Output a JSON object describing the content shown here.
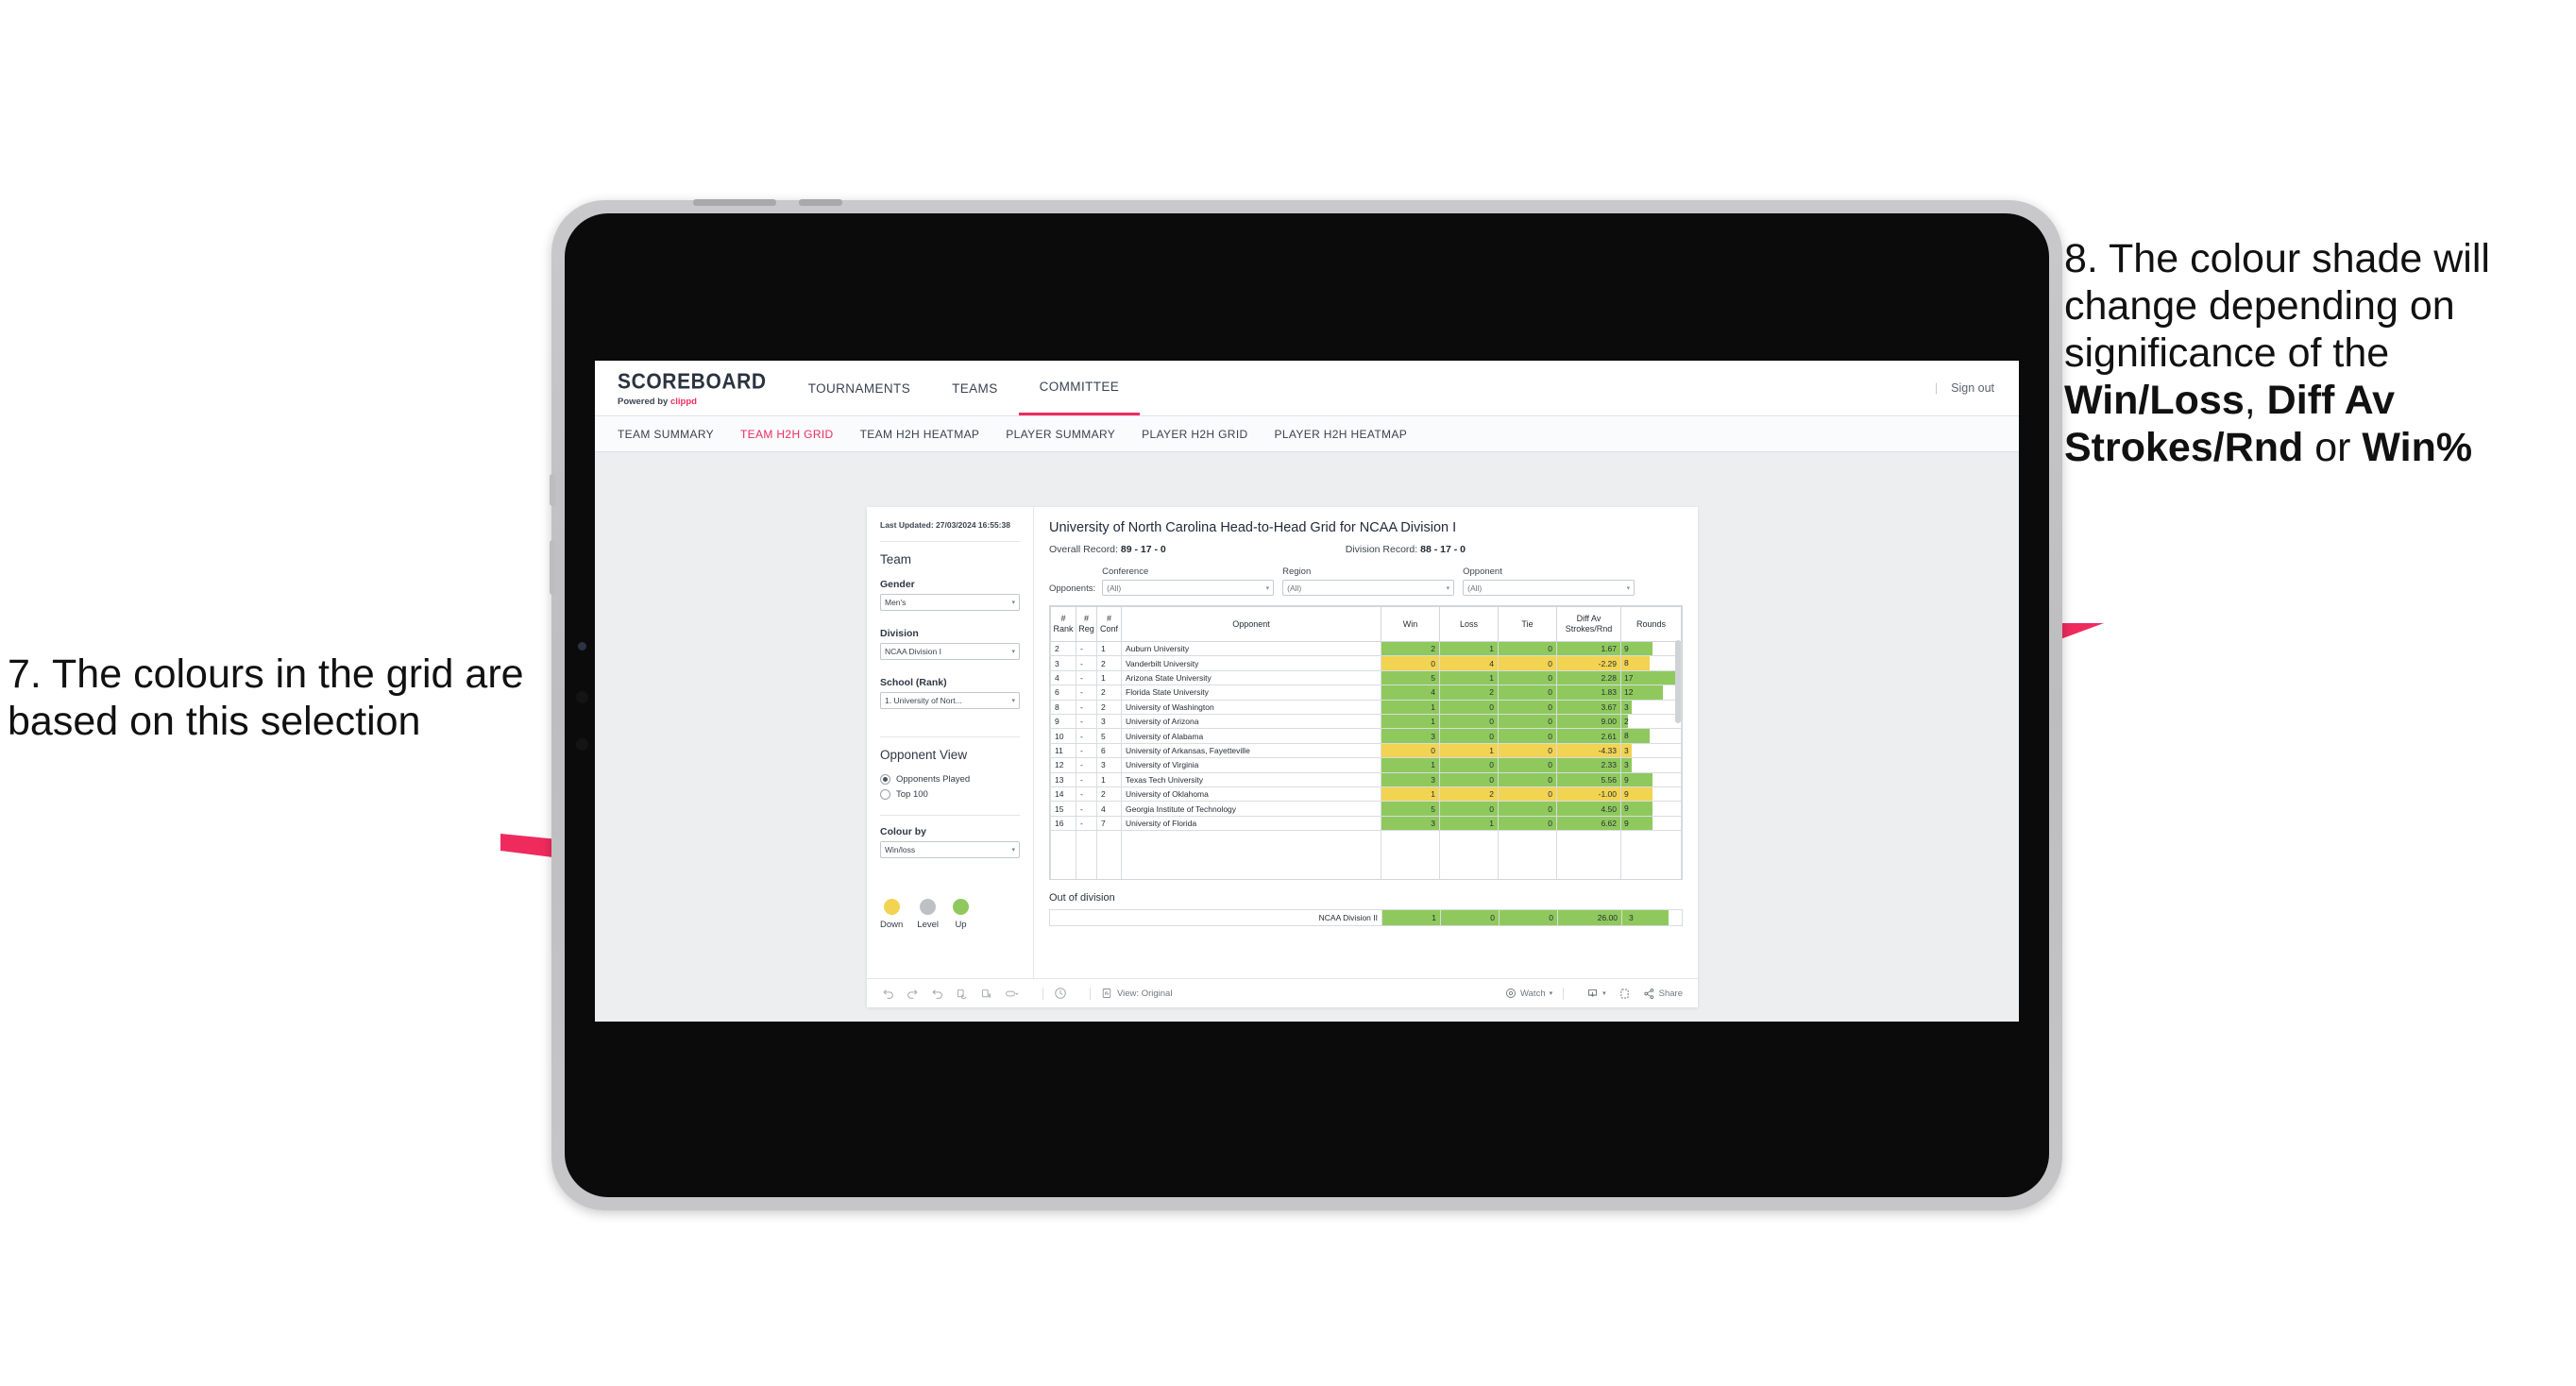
{
  "annotations": {
    "left": {
      "text": "7. The colours in the grid are based on this selection"
    },
    "right": {
      "pre": "8. The colour shade will change depending on significance of the ",
      "b1": "Win/Loss",
      "mid1": ", ",
      "b2": "Diff Av Strokes/Rnd",
      "mid2": " or ",
      "b3": "Win%"
    },
    "arrow_color": "#ef2b5e"
  },
  "app": {
    "brand": {
      "title": "SCOREBOARD",
      "powered_pre": "Powered by ",
      "powered_brand": "clippd"
    },
    "nav": [
      {
        "label": "TOURNAMENTS",
        "active": false
      },
      {
        "label": "TEAMS",
        "active": false
      },
      {
        "label": "COMMITTEE",
        "active": true
      }
    ],
    "sign_out": "Sign out",
    "subnav": [
      {
        "label": "TEAM SUMMARY",
        "active": false
      },
      {
        "label": "TEAM H2H GRID",
        "active": true
      },
      {
        "label": "TEAM H2H HEATMAP",
        "active": false
      },
      {
        "label": "PLAYER SUMMARY",
        "active": false
      },
      {
        "label": "PLAYER H2H GRID",
        "active": false
      },
      {
        "label": "PLAYER H2H HEATMAP",
        "active": false
      }
    ]
  },
  "sidebar": {
    "last_updated": "Last Updated: 27/03/2024 16:55:38",
    "team_heading": "Team",
    "gender": {
      "label": "Gender",
      "value": "Men's"
    },
    "division": {
      "label": "Division",
      "value": "NCAA Division I"
    },
    "school": {
      "label": "School (Rank)",
      "value": "1. University of Nort..."
    },
    "opponent_view": {
      "heading": "Opponent View",
      "options": [
        {
          "label": "Opponents Played",
          "selected": true
        },
        {
          "label": "Top 100",
          "selected": false
        }
      ]
    },
    "colour_by": {
      "label": "Colour by",
      "value": "Win/loss"
    },
    "legend": [
      {
        "label": "Down",
        "color": "#f2d352"
      },
      {
        "label": "Level",
        "color": "#bdc1c6"
      },
      {
        "label": "Up",
        "color": "#8fc95d"
      }
    ]
  },
  "viz": {
    "title": "University of North Carolina Head-to-Head Grid for NCAA Division I",
    "overall_record_label": "Overall Record: ",
    "overall_record_value": "89 - 17 - 0",
    "division_record_label": "Division Record: ",
    "division_record_value": "88 - 17 - 0",
    "opponents_label": "Opponents:",
    "filters": [
      {
        "label": "Conference",
        "value": "(All)"
      },
      {
        "label": "Region",
        "value": "(All)"
      },
      {
        "label": "Opponent",
        "value": "(All)"
      }
    ],
    "out_of_division_title": "Out of division"
  },
  "chart_data": {
    "type": "table",
    "title": "University of North Carolina Head-to-Head Grid for NCAA Division I",
    "columns": [
      "# Rank",
      "# Reg",
      "# Conf",
      "Opponent",
      "Win",
      "Loss",
      "Tie",
      "Diff Av Strokes/Rnd",
      "Rounds"
    ],
    "column_header_lines": [
      [
        "#",
        "Rank"
      ],
      [
        "#",
        "Reg"
      ],
      [
        "#",
        "Conf"
      ],
      [
        "Opponent"
      ],
      [
        "Win"
      ],
      [
        "Loss"
      ],
      [
        "Tie"
      ],
      [
        "Diff Av",
        "Strokes/Rnd"
      ],
      [
        "Rounds"
      ]
    ],
    "colour_scale": {
      "up": "#8fc95d",
      "down": "#f2d352",
      "level": "#bdc1c6"
    },
    "rounds_max": 17,
    "rows": [
      {
        "rank": "2",
        "reg": "-",
        "conf": "1",
        "opponent": "Auburn University",
        "win": "2",
        "loss": "1",
        "tie": "0",
        "diff": "1.67",
        "rounds": "9",
        "rounds_val": 9,
        "shade": "up"
      },
      {
        "rank": "3",
        "reg": "-",
        "conf": "2",
        "opponent": "Vanderbilt University",
        "win": "0",
        "loss": "4",
        "tie": "0",
        "diff": "-2.29",
        "rounds": "8",
        "rounds_val": 8,
        "shade": "down"
      },
      {
        "rank": "4",
        "reg": "-",
        "conf": "1",
        "opponent": "Arizona State University",
        "win": "5",
        "loss": "1",
        "tie": "0",
        "diff": "2.28",
        "rounds": "17",
        "rounds_val": 17,
        "shade": "up"
      },
      {
        "rank": "6",
        "reg": "-",
        "conf": "2",
        "opponent": "Florida State University",
        "win": "4",
        "loss": "2",
        "tie": "0",
        "diff": "1.83",
        "rounds": "12",
        "rounds_val": 12,
        "shade": "up"
      },
      {
        "rank": "8",
        "reg": "-",
        "conf": "2",
        "opponent": "University of Washington",
        "win": "1",
        "loss": "0",
        "tie": "0",
        "diff": "3.67",
        "rounds": "3",
        "rounds_val": 3,
        "shade": "up"
      },
      {
        "rank": "9",
        "reg": "-",
        "conf": "3",
        "opponent": "University of Arizona",
        "win": "1",
        "loss": "0",
        "tie": "0",
        "diff": "9.00",
        "rounds": "2",
        "rounds_val": 2,
        "shade": "up"
      },
      {
        "rank": "10",
        "reg": "-",
        "conf": "5",
        "opponent": "University of Alabama",
        "win": "3",
        "loss": "0",
        "tie": "0",
        "diff": "2.61",
        "rounds": "8",
        "rounds_val": 8,
        "shade": "up"
      },
      {
        "rank": "11",
        "reg": "-",
        "conf": "6",
        "opponent": "University of Arkansas, Fayetteville",
        "win": "0",
        "loss": "1",
        "tie": "0",
        "diff": "-4.33",
        "rounds": "3",
        "rounds_val": 3,
        "shade": "down"
      },
      {
        "rank": "12",
        "reg": "-",
        "conf": "3",
        "opponent": "University of Virginia",
        "win": "1",
        "loss": "0",
        "tie": "0",
        "diff": "2.33",
        "rounds": "3",
        "rounds_val": 3,
        "shade": "up"
      },
      {
        "rank": "13",
        "reg": "-",
        "conf": "1",
        "opponent": "Texas Tech University",
        "win": "3",
        "loss": "0",
        "tie": "0",
        "diff": "5.56",
        "rounds": "9",
        "rounds_val": 9,
        "shade": "up"
      },
      {
        "rank": "14",
        "reg": "-",
        "conf": "2",
        "opponent": "University of Oklahoma",
        "win": "1",
        "loss": "2",
        "tie": "0",
        "diff": "-1.00",
        "rounds": "9",
        "rounds_val": 9,
        "shade": "down"
      },
      {
        "rank": "15",
        "reg": "-",
        "conf": "4",
        "opponent": "Georgia Institute of Technology",
        "win": "5",
        "loss": "0",
        "tie": "0",
        "diff": "4.50",
        "rounds": "9",
        "rounds_val": 9,
        "shade": "up"
      },
      {
        "rank": "16",
        "reg": "-",
        "conf": "7",
        "opponent": "University of Florida",
        "win": "3",
        "loss": "1",
        "tie": "0",
        "diff": "6.62",
        "rounds": "9",
        "rounds_val": 9,
        "shade": "up"
      }
    ],
    "out_of_division": {
      "label": "NCAA Division II",
      "win": "1",
      "loss": "0",
      "tie": "0",
      "diff": "26.00",
      "rounds": "3",
      "shade": "up"
    }
  },
  "toolbar": {
    "view_label": "View: Original",
    "watch_label": "Watch",
    "share_label": "Share"
  }
}
